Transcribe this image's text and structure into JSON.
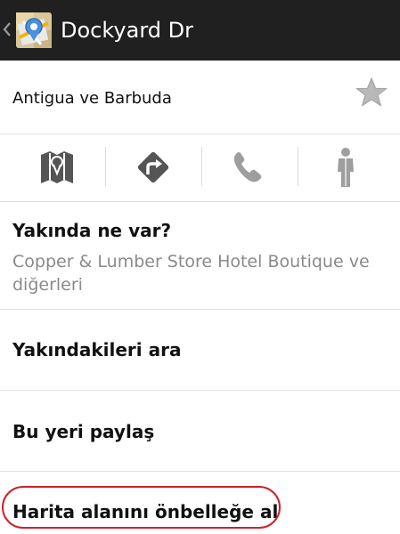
{
  "header": {
    "title": "Dockyard Dr",
    "icons": [
      "chevron-left-icon",
      "maps-app-icon"
    ]
  },
  "place": {
    "subtitle": "Antigua ve Barbuda",
    "favorite_icon": "star-icon"
  },
  "actions": [
    {
      "name": "map",
      "icon": "map-icon",
      "enabled": true
    },
    {
      "name": "directions",
      "icon": "directions-icon",
      "enabled": true
    },
    {
      "name": "call",
      "icon": "phone-icon",
      "enabled": false
    },
    {
      "name": "street-view",
      "icon": "pegman-icon",
      "enabled": false
    }
  ],
  "menu": {
    "nearby_title": "Yakında ne var?",
    "nearby_subtitle": "Copper & Lumber Store Hotel Boutique ve diğerleri",
    "search_nearby": "Yakındakileri ara",
    "share_place": "Bu yeri paylaş",
    "cache_map": "Harita alanını önbelleğe al"
  },
  "colors": {
    "header_bg": "#202020",
    "header_text": "#ffffff",
    "icon_active": "#555555",
    "icon_disabled": "#9e9e9e",
    "highlight": "#d0202a"
  }
}
